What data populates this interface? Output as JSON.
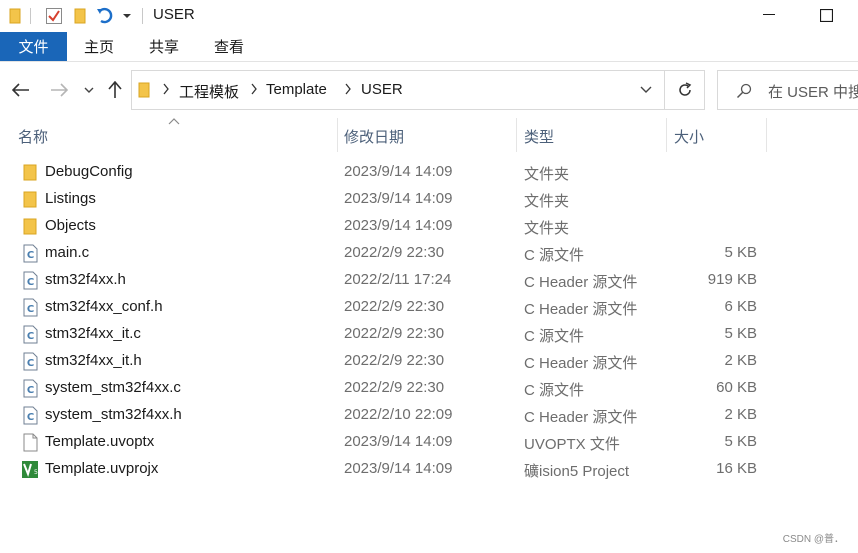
{
  "window": {
    "title": "USER",
    "minimize_icon": "minimize-icon",
    "maximize_icon": "maximize-icon"
  },
  "ribbon": {
    "tabs": [
      {
        "label": "文件",
        "active": true
      },
      {
        "label": "主页"
      },
      {
        "label": "共享"
      },
      {
        "label": "查看"
      }
    ],
    "accent": "#1a66b8"
  },
  "address": {
    "crumbs": [
      "工程模板",
      "Template",
      "USER"
    ],
    "search_placeholder": "在 USER 中搜"
  },
  "columns": {
    "name": "名称",
    "date": "修改日期",
    "type": "类型",
    "size": "大小"
  },
  "files": [
    {
      "icon": "folder-icon",
      "name": "DebugConfig",
      "date": "2023/9/14 14:09",
      "type": "文件夹",
      "size": ""
    },
    {
      "icon": "folder-icon",
      "name": "Listings",
      "date": "2023/9/14 14:09",
      "type": "文件夹",
      "size": ""
    },
    {
      "icon": "folder-icon",
      "name": "Objects",
      "date": "2023/9/14 14:09",
      "type": "文件夹",
      "size": ""
    },
    {
      "icon": "c-file-icon",
      "name": "main.c",
      "date": "2022/2/9 22:30",
      "type": "C 源文件",
      "size": "5 KB"
    },
    {
      "icon": "c-file-icon",
      "name": "stm32f4xx.h",
      "date": "2022/2/11 17:24",
      "type": "C Header 源文件",
      "size": "919 KB"
    },
    {
      "icon": "c-file-icon",
      "name": "stm32f4xx_conf.h",
      "date": "2022/2/9 22:30",
      "type": "C Header 源文件",
      "size": "6 KB"
    },
    {
      "icon": "c-file-icon",
      "name": "stm32f4xx_it.c",
      "date": "2022/2/9 22:30",
      "type": "C 源文件",
      "size": "5 KB"
    },
    {
      "icon": "c-file-icon",
      "name": "stm32f4xx_it.h",
      "date": "2022/2/9 22:30",
      "type": "C Header 源文件",
      "size": "2 KB"
    },
    {
      "icon": "c-file-icon",
      "name": "system_stm32f4xx.c",
      "date": "2022/2/9 22:30",
      "type": "C 源文件",
      "size": "60 KB"
    },
    {
      "icon": "c-file-icon",
      "name": "system_stm32f4xx.h",
      "date": "2022/2/10 22:09",
      "type": "C Header 源文件",
      "size": "2 KB"
    },
    {
      "icon": "generic-file-icon",
      "name": "Template.uvoptx",
      "date": "2023/9/14 14:09",
      "type": "UVOPTX 文件",
      "size": "5 KB"
    },
    {
      "icon": "keil-project-icon",
      "name": "Template.uvprojx",
      "date": "2023/9/14 14:09",
      "type": "礦ision5 Project",
      "size": "16 KB"
    }
  ],
  "watermark": "CSDN @普．"
}
